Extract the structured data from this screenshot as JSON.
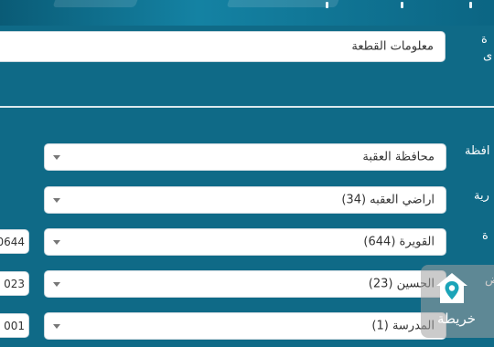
{
  "header": {},
  "parcel_info": {
    "label": "ة",
    "label_line2": "ى",
    "value": "معلومات القطعة"
  },
  "form": {
    "governorate": {
      "label": "افظة",
      "value": "محافظة العقبة"
    },
    "lands": {
      "label": "رية",
      "value": "اراضي العقبه (34)"
    },
    "village": {
      "label": "ة",
      "value": "القويرة (644)",
      "code": "0644"
    },
    "basin": {
      "label": "ض",
      "value": "الحسين (23)",
      "code": "023"
    },
    "neighborhood": {
      "label": "",
      "value": "المدرسة (1)",
      "code": "001"
    }
  },
  "map_button": {
    "label": "خريطة",
    "icon": "house-map-icon"
  },
  "colors": {
    "background": "#0f6a87",
    "field_bg": "#ffffff",
    "text": "#333333",
    "label_text": "#ffffff"
  }
}
